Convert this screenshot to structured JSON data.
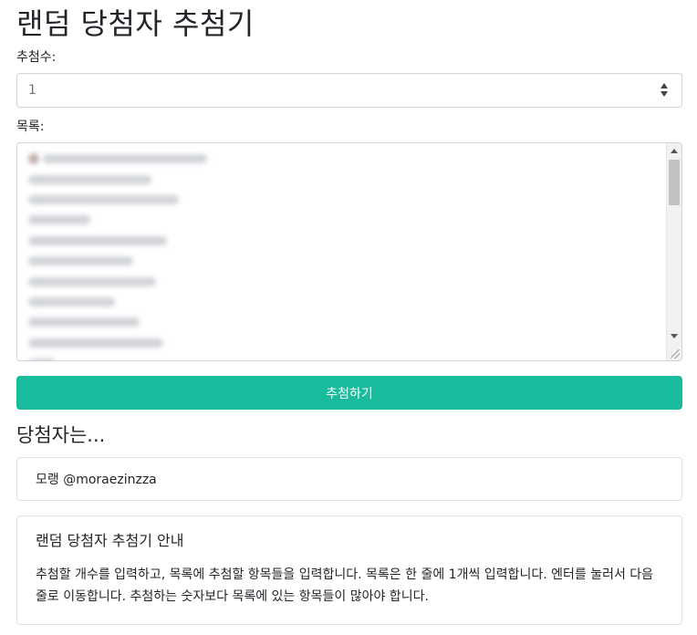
{
  "page": {
    "title": "랜덤 당첨자 추첨기"
  },
  "count_field": {
    "label": "추첨수:",
    "value": "1"
  },
  "list_field": {
    "label": "목록:",
    "content_blurred": true,
    "visible_line_count": 10
  },
  "draw_button": {
    "label": "추첨하기",
    "color": "#18bc9c"
  },
  "result": {
    "heading": "당첨자는...",
    "winner": "모랭 @moraezinzza"
  },
  "info": {
    "title": "랜덤 당첨자 추첨기 안내",
    "text": "추첨할 개수를 입력하고, 목록에 추첨할 항목들을 입력합니다. 목록은 한 줄에 1개씩 입력합니다. 엔터를 눌러서 다음 줄로 이동합니다. 추첨하는 숫자보다 목록에 있는 항목들이 많아야 합니다."
  }
}
